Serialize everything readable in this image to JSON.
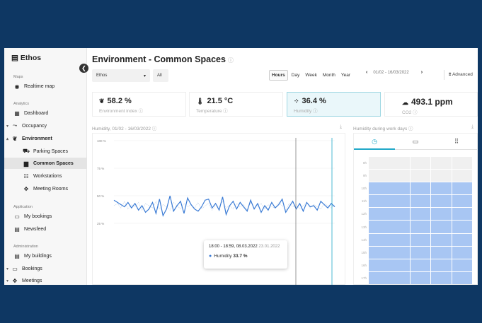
{
  "sidebar": {
    "brand": "Ethos",
    "sections": {
      "maps": "Maps",
      "analytics": "Analytics",
      "application": "Application",
      "administration": "Administration"
    },
    "items": {
      "realtime_map": "Realtime map",
      "dashboard": "Dashboard",
      "occupancy": "Occupancy",
      "environment": "Environment",
      "parking_spaces": "Parking Spaces",
      "common_spaces": "Common Spaces",
      "workstations": "Workstations",
      "meeting_rooms": "Meeting Rooms",
      "my_bookings": "My bookings",
      "newsfeed": "Newsfeed",
      "my_buildings": "My buildings",
      "bookings": "Bookings",
      "meetings": "Meetings"
    }
  },
  "header": {
    "title": "Environment - Common Spaces",
    "info_icon": "ⓘ"
  },
  "filters": {
    "building": "Ethos",
    "scope": "All"
  },
  "periods": [
    "Hours",
    "Day",
    "Week",
    "Month",
    "Year"
  ],
  "active_period": "Hours",
  "date_range": "01/02 - 16/03/2022",
  "advanced_label": "Advanced",
  "kpis": [
    {
      "value": "58.2 %",
      "label": "Environment index ⓘ",
      "icon": "leaf-icon"
    },
    {
      "value": "21.5 °C",
      "label": "Temperature ⓘ",
      "icon": "thermometer-icon"
    },
    {
      "value": "36.4 %",
      "label": "Humidity ⓘ",
      "icon": "humidity-icon"
    },
    {
      "value": "493.1 ppm",
      "label": "CO2 ⓘ",
      "icon": "cloud-icon"
    }
  ],
  "humidity_chart": {
    "title": "Humidity, 01/02 - 16/03/2022 ⓘ",
    "y_ticks": [
      "100 %",
      "75 %",
      "50 %",
      "25 %"
    ]
  },
  "tooltip": {
    "time": "18:00 - 18:59, 08.03.2022",
    "compare_date": "23.01.2022",
    "series": "Humidity",
    "value": "33.7 %"
  },
  "heatmap": {
    "title": "Humidity during work days ⓘ",
    "hours": [
      "8h",
      "9h",
      "10h",
      "11h",
      "12h",
      "13h",
      "14h",
      "15h",
      "16h",
      "17h"
    ],
    "tabs": [
      "clock-icon",
      "calendar-icon",
      "grid-icon"
    ]
  },
  "chart_data": {
    "type": "line",
    "title": "Humidity, 01/02 - 16/03/2022",
    "ylim": [
      0,
      100
    ],
    "y_ticks": [
      100,
      75,
      50,
      25
    ],
    "series": [
      {
        "name": "Humidity",
        "color": "#3a7bd5",
        "values": [
          46,
          44,
          42,
          40,
          44,
          39,
          43,
          37,
          41,
          35,
          38,
          44,
          34,
          47,
          32,
          38,
          50,
          36,
          41,
          45,
          34,
          48,
          42,
          38,
          36,
          40,
          46,
          47,
          39,
          43,
          37,
          49,
          33,
          41,
          45,
          38,
          44,
          40,
          36,
          46,
          38,
          43,
          35,
          41,
          37,
          44,
          39,
          42,
          47,
          35,
          40,
          45,
          38,
          43,
          36,
          44,
          40,
          41,
          37,
          45,
          42,
          39,
          43,
          40
        ]
      },
      {
        "name": "",
        "color": "#c4d3e8",
        "values": [
          41,
          43,
          39,
          45,
          38,
          42,
          40,
          44,
          37,
          43,
          41,
          39,
          45,
          38,
          42,
          40,
          37,
          44,
          41,
          38,
          43,
          40,
          42,
          39,
          44,
          38,
          41,
          43,
          37,
          42,
          40,
          45,
          39,
          41,
          38,
          43,
          40,
          42,
          37,
          44,
          39,
          41,
          43,
          38,
          42,
          40,
          39,
          44,
          41,
          37,
          43,
          40,
          42,
          38,
          41,
          44,
          39,
          42,
          40,
          38,
          43,
          41,
          39,
          42
        ]
      }
    ]
  }
}
